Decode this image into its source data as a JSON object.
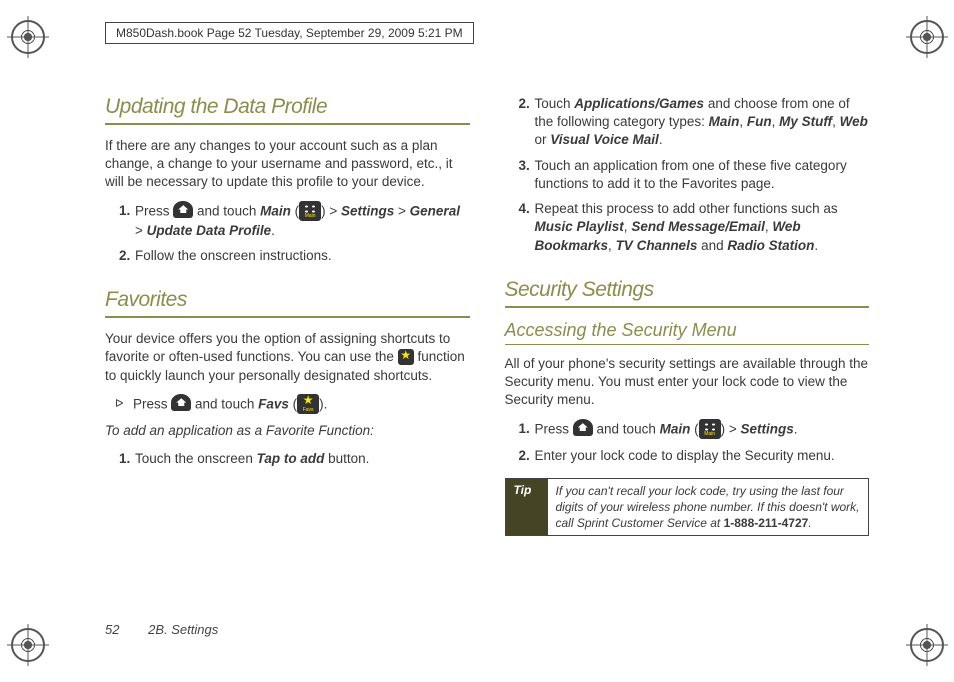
{
  "header_bar": "M850Dash.book  Page 52  Tuesday, September 29, 2009  5:21 PM",
  "left": {
    "h1": "Updating the Data Profile",
    "intro": "If there are any changes to your account such as a plan change, a change to your username and password, etc., it will be necessary to update this profile to your device.",
    "step1_a": "Press ",
    "step1_b": " and touch ",
    "step1_main": "Main",
    "step1_c": " (",
    "step1_d": ") > ",
    "step1_settings": "Settings",
    "step1_e": " > ",
    "step1_general": "General",
    "step1_f": " > ",
    "step1_update": "Update Data Profile",
    "step1_g": ".",
    "step2": "Follow the onscreen instructions.",
    "h2": "Favorites",
    "fav_intro_a": "Your device offers you the option of assigning shortcuts to favorite or often-used functions. You can use the ",
    "fav_intro_b": " function to quickly launch your personally designated shortcuts.",
    "fav_bullet_a": "Press ",
    "fav_bullet_b": " and touch ",
    "fav_bullet_favs": "Favs",
    "fav_bullet_c": " (",
    "fav_bullet_d": ").",
    "fav_sub": "To add an application as a Favorite Function:",
    "fav_step1_a": "Touch the onscreen ",
    "fav_step1_b": "Tap to add",
    "fav_step1_c": " button."
  },
  "right": {
    "step2_a": "Touch ",
    "step2_apps": "Applications/Games",
    "step2_b": " and choose from one of the following category types: ",
    "step2_main": "Main",
    "step2_c": ", ",
    "step2_fun": "Fun",
    "step2_d": ", ",
    "step2_mystuff": "My Stuff",
    "step2_e": ", ",
    "step2_web": "Web",
    "step2_or": " or ",
    "step2_vvm": "Visual Voice Mail",
    "step2_f": ".",
    "step3": "Touch an application from one of these five category functions to add it to the Favorites page.",
    "step4_a": "Repeat this process to add other functions such as ",
    "step4_mp": "Music Playlist",
    "step4_b": ", ",
    "step4_sm": "Send Message/Email",
    "step4_c": ", ",
    "step4_wb": "Web Bookmarks",
    "step4_d": ", ",
    "step4_tv": "TV Channels",
    "step4_and": " and ",
    "step4_rs": "Radio Station",
    "step4_e": ".",
    "h1": "Security Settings",
    "h2": "Accessing the Security Menu",
    "sec_intro": "All of your phone's security settings are available through the Security menu. You must enter your lock code to view the Security menu.",
    "sec1_a": "Press ",
    "sec1_b": " and touch ",
    "sec1_main": "Main",
    "sec1_c": " (",
    "sec1_d": ") > ",
    "sec1_settings": "Settings",
    "sec1_e": ".",
    "sec2": "Enter your lock code to display the Security menu.",
    "tip_label": "Tip",
    "tip_body_a": "If you can't recall your lock code, try using the last four digits of your wireless phone number. If this doesn't work, call Sprint Customer Service at ",
    "tip_phone": "1-888-211-4727",
    "tip_body_b": "."
  },
  "footer": {
    "page": "52",
    "section": "2B. Settings"
  }
}
